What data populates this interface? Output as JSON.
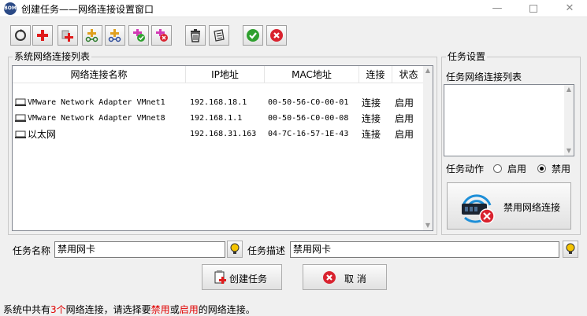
{
  "window": {
    "app_icon_text": "BOM",
    "title": "创建任务——网络连接设置窗口",
    "minimize": "—",
    "close": "✕"
  },
  "toolbar": {
    "buttons": [
      {
        "name": "refresh-icon"
      },
      {
        "name": "add-icon"
      },
      {
        "name": "add-multiple-icon"
      },
      {
        "name": "network-add-icon"
      },
      {
        "name": "network-icon"
      },
      {
        "name": "enable-icon"
      },
      {
        "name": "disable-icon"
      },
      {
        "name": "delete-icon"
      },
      {
        "name": "clear-icon"
      },
      {
        "name": "confirm-icon"
      },
      {
        "name": "cancel-icon"
      }
    ]
  },
  "system_list": {
    "group_title": "系统网络连接列表",
    "columns": [
      "网络连接名称",
      "IP地址",
      "MAC地址",
      "连接",
      "状态"
    ],
    "rows": [
      {
        "name": "VMware Network Adapter VMnet1",
        "ip": "192.168.18.1",
        "mac": "00-50-56-C0-00-01",
        "connect": "连接",
        "status": "启用"
      },
      {
        "name": "VMware Network Adapter VMnet8",
        "ip": "192.168.1.1",
        "mac": "00-50-56-C0-00-08",
        "connect": "连接",
        "status": "启用"
      },
      {
        "name": "以太网",
        "ip": "192.168.31.163",
        "mac": "04-7C-16-57-1E-43",
        "connect": "连接",
        "status": "启用"
      }
    ]
  },
  "task_settings": {
    "group_title": "任务设置",
    "list_label": "任务网络连接列表",
    "action_label": "任务动作",
    "enable_label": "启用",
    "disable_label": "禁用",
    "selected_action": "禁用",
    "big_button_label": "禁用网络连接"
  },
  "form": {
    "name_label": "任务名称",
    "name_value": "禁用网卡",
    "desc_label": "任务描述",
    "desc_value": "禁用网卡"
  },
  "actions": {
    "create_label": "创建任务",
    "cancel_label": "取 消"
  },
  "status": {
    "prefix": "系统中共有",
    "count": "3个",
    "middle": "网络连接，请选择要",
    "disable_word": "禁用",
    "or": "或",
    "enable_word": "启用",
    "suffix": "的网络连接。"
  },
  "colors": {
    "highlight": "#e00000",
    "accent_green": "#2fa02f",
    "accent_red": "#d9232f"
  }
}
